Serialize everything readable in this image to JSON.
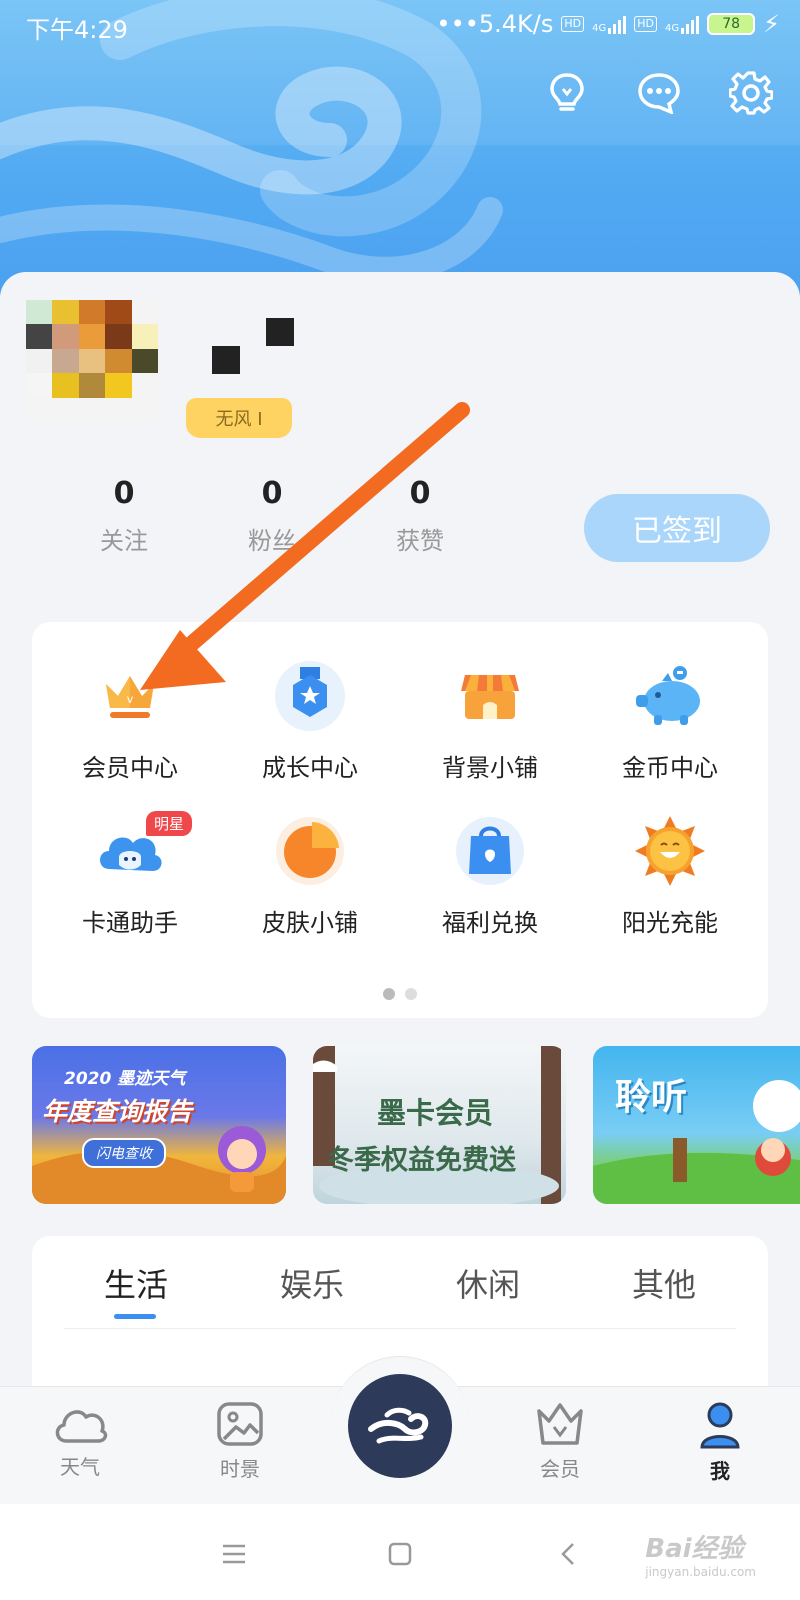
{
  "status_bar": {
    "time": "下午4:29",
    "net_speed": "•••5.4K/s",
    "hd_label": "HD",
    "network_label": "4G",
    "battery": "78"
  },
  "profile": {
    "level_badge": "无风 I",
    "stats": [
      {
        "value": "0",
        "label": "关注"
      },
      {
        "value": "0",
        "label": "粉丝"
      },
      {
        "value": "0",
        "label": "获赞"
      }
    ],
    "signin_label": "已签到"
  },
  "features": [
    {
      "label": "会员中心",
      "icon": "crown-icon"
    },
    {
      "label": "成长中心",
      "icon": "medal-icon"
    },
    {
      "label": "背景小铺",
      "icon": "shop-icon"
    },
    {
      "label": "金币中心",
      "icon": "piggy-bank-icon"
    },
    {
      "label": "卡通助手",
      "icon": "cartoon-cloud-icon",
      "tag": "明星"
    },
    {
      "label": "皮肤小铺",
      "icon": "pie-icon"
    },
    {
      "label": "福利兑换",
      "icon": "gift-bag-icon"
    },
    {
      "label": "阳光充能",
      "icon": "sun-icon"
    }
  ],
  "banners": [
    {
      "line1": "2020 墨迹天气",
      "line2": "年度查询报告",
      "button": "闪电查收"
    },
    {
      "line1": "墨卡会员",
      "line2": "冬季权益免费送"
    },
    {
      "line1": "聆听"
    }
  ],
  "tabs": [
    "生活",
    "娱乐",
    "休闲",
    "其他"
  ],
  "bottom_nav": [
    {
      "label": "天气",
      "icon": "cloud-icon"
    },
    {
      "label": "时景",
      "icon": "image-icon"
    },
    {
      "label": "会员",
      "icon": "crown-outline-icon"
    },
    {
      "label": "我",
      "icon": "person-icon"
    }
  ],
  "watermark": {
    "main": "Bai经验",
    "sub": "jingyan.baidu.com"
  },
  "colors": {
    "accent": "#3a8ff0",
    "hero": "#52aaf2",
    "arrow": "#f36b21",
    "tag": "#f0484a"
  }
}
